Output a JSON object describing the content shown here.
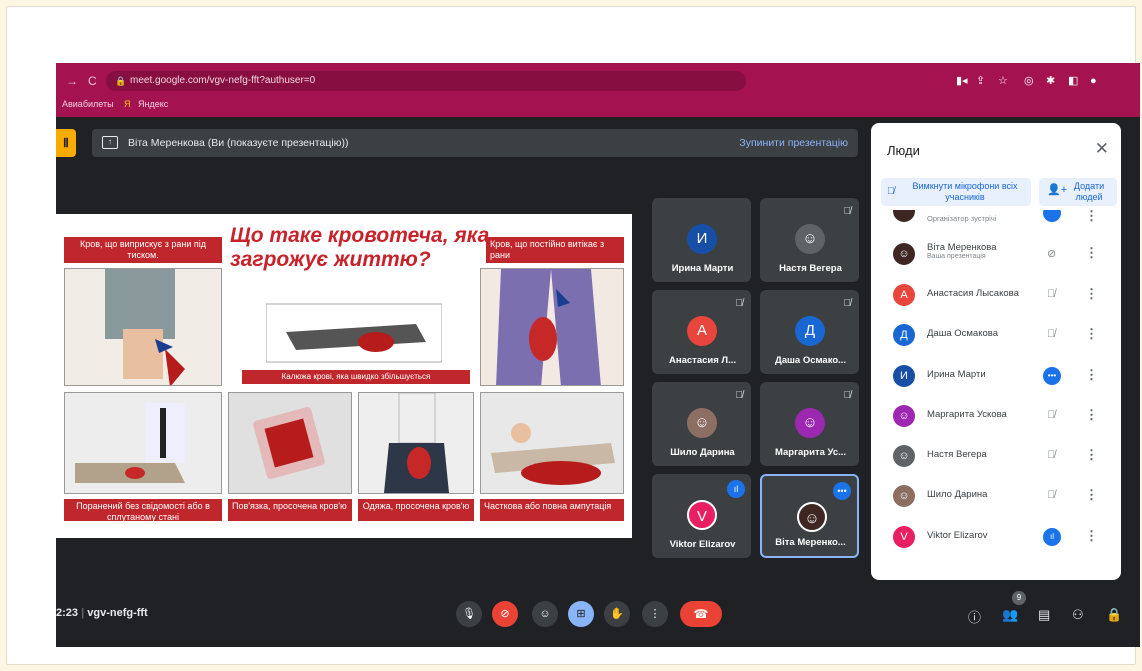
{
  "browser": {
    "url": "meet.google.com/vgv-nefg-fft?authuser=0",
    "bookmarks": [
      "Авиабилеты",
      "Яндекс"
    ]
  },
  "banner": {
    "presenter_text": "Віта Меренкова (Ви (показуєте презентацію))",
    "stop_label": "Зупинити презентацію"
  },
  "slide": {
    "title": "Що таке кровотеча, яка загрожує життю?",
    "cap_top_left": "Кров, що виприскує з рани під тиском.",
    "cap_top_right": "Кров, що постійно витікає з рани",
    "cap_middle": "Калюжа крові, яка швидко збільшується",
    "cap_bottom_1": "Поранений без свідомості або в сплутаному стані",
    "cap_bottom_2": "Пов'язка, просочена кров'ю",
    "cap_bottom_3": "Одяжа, просочена кров'ю",
    "cap_bottom_4": "Часткова або повна ампутація"
  },
  "tiles": [
    {
      "name": "Ирина Марти",
      "initial": "И",
      "color": "#174ea6"
    },
    {
      "name": "Настя Вегера",
      "initial": "",
      "color": "#5f6368"
    },
    {
      "name": "Анастасия Л...",
      "initial": "А",
      "color": "#e8453c"
    },
    {
      "name": "Даша Осмако...",
      "initial": "Д",
      "color": "#1967d2"
    },
    {
      "name": "Шило Дарина",
      "initial": "",
      "color": "#8d6e63"
    },
    {
      "name": "Маргарита Ус...",
      "initial": "",
      "color": "#9c27b0"
    },
    {
      "name": "Viktor Elizarov",
      "initial": "V",
      "color": "#e91e63"
    },
    {
      "name": "Віта Меренко...",
      "initial": "",
      "color": "#3e2723"
    }
  ],
  "bottom": {
    "time": "2:23",
    "meeting_code": "vgv-nefg-fft",
    "people_count": "9"
  },
  "panel": {
    "title": "Люди",
    "mute_all": "Вимкнути мікрофони всіх учасників",
    "add_people": "Додати людей",
    "organizer_label": "Організатор зустрічі",
    "participants": [
      {
        "name": "Віта Меренкова",
        "sub": "Ваша презентація",
        "initial": "",
        "color": "#3e2723"
      },
      {
        "name": "Анастасия Лысакова",
        "sub": "",
        "initial": "А",
        "color": "#e8453c"
      },
      {
        "name": "Даша Осмакова",
        "sub": "",
        "initial": "Д",
        "color": "#1967d2"
      },
      {
        "name": "Ирина Марти",
        "sub": "",
        "initial": "И",
        "color": "#174ea6"
      },
      {
        "name": "Маргарита Ускова",
        "sub": "",
        "initial": "",
        "color": "#9c27b0"
      },
      {
        "name": "Настя Вегера",
        "sub": "",
        "initial": "",
        "color": "#5f6368"
      },
      {
        "name": "Шило Дарина",
        "sub": "",
        "initial": "",
        "color": "#8d6e63"
      },
      {
        "name": "Viktor Elizarov",
        "sub": "",
        "initial": "V",
        "color": "#e91e63"
      }
    ]
  },
  "colors": {
    "accent": "#1a73e8",
    "chrome": "#a4124f",
    "end_call": "#ea4335",
    "slide_red": "#c0272d"
  }
}
